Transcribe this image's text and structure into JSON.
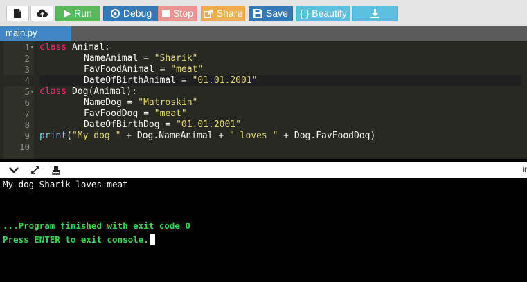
{
  "toolbar": {
    "file_icon": "file-icon",
    "upload_icon": "upload-icon",
    "run_label": "Run",
    "debug_label": "Debug",
    "stop_label": "Stop",
    "share_label": "Share",
    "save_label": "Save",
    "beautify_label": "{ } Beautify",
    "download_icon": "download-icon"
  },
  "tabs": [
    {
      "label": "main.py",
      "active": true
    }
  ],
  "editor": {
    "active_line": 4,
    "lines": [
      {
        "num": "1",
        "fold": true
      },
      {
        "num": "2",
        "fold": false
      },
      {
        "num": "3",
        "fold": false
      },
      {
        "num": "4",
        "fold": false
      },
      {
        "num": "5",
        "fold": true
      },
      {
        "num": "6",
        "fold": false
      },
      {
        "num": "7",
        "fold": false
      },
      {
        "num": "8",
        "fold": false
      },
      {
        "num": "9",
        "fold": false
      },
      {
        "num": "10",
        "fold": false
      }
    ],
    "tokens": {
      "l1_kw": "class",
      "l1_rest": " Animal:",
      "l2_name": "NameAnimal = ",
      "l2_val": "\"Sharik\"",
      "l3_name": "FavFoodAnimal = ",
      "l3_val": "\"meat\"",
      "l4_name": "DateOfBirthAnimal = ",
      "l4_val": "\"01.01.2001\"",
      "l5_kw": "class",
      "l5_rest": " Dog(Animal):",
      "l6_name": "NameDog = ",
      "l6_val": "\"Matroskin\"",
      "l7_name": "FavFoodDog = ",
      "l7_val": "\"meat\"",
      "l8_name": "DateOfBirthDog = ",
      "l8_val": "\"01.01.2001\"",
      "l9_fn": "print",
      "l9_open": "(",
      "l9_s1": "\"My dog \"",
      "l9_mid1": " + Dog.NameAnimal + ",
      "l9_s2": "\" loves \"",
      "l9_mid2": " + Dog.FavFoodDog)"
    }
  },
  "console_header": {
    "collapse_icon": "chevron-down-icon",
    "expand_icon": "expand-icon",
    "clear_icon": "eraser-icon",
    "edge_text": "ir"
  },
  "console": {
    "output_line": "My dog Sharik loves meat",
    "finished_line": "...Program finished with exit code 0",
    "press_line": "Press ENTER to exit console."
  },
  "colors": {
    "run": "#5cb85c",
    "debug": "#337ab7",
    "stop": "#ec9494",
    "share": "#f0ad4e",
    "save": "#337ab7",
    "beautify": "#5bc0de",
    "editor_bg": "#272822",
    "keyword": "#f92672",
    "string": "#e6db74",
    "builtin": "#66d9ef",
    "console_green": "#39d352"
  }
}
